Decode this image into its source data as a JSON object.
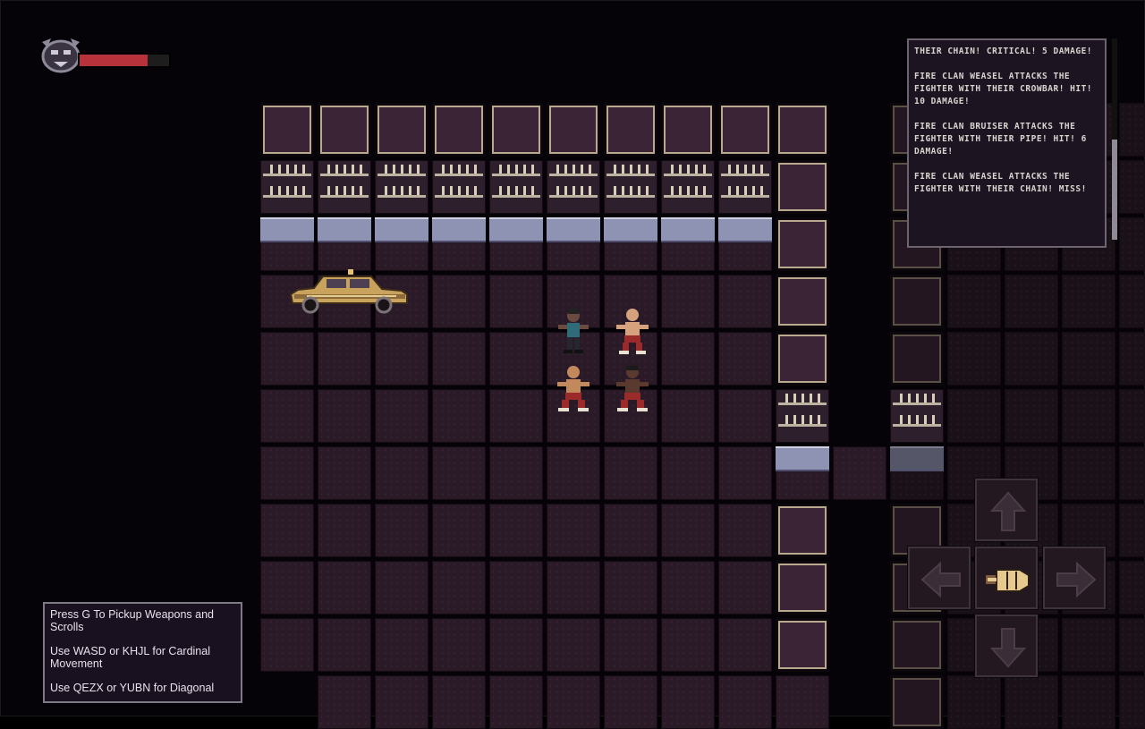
{
  "hud": {
    "health_fraction": 0.76,
    "colors": {
      "health": "#b7323a",
      "health_bg": "#1d1d1d"
    }
  },
  "combat_log": {
    "entries": [
      "Their chain! Critical! 5 damage!",
      "Fire Clan Weasel attacks the Fighter with their crowbar! Hit! 10 damage!",
      "Fire Clan Bruiser attacks the Fighter with their pipe! Hit! 6 damage!",
      "Fire Clan Weasel attacks the Fighter with their chain! Miss!"
    ]
  },
  "help": {
    "lines": [
      "Press G To Pickup Weapons and Scrolls",
      "Use WASD or KHJL for Cardinal Movement",
      "Use QEZX or YUBN for Diagonal"
    ]
  },
  "dpad": {
    "up": "arrow-up-icon",
    "down": "arrow-down-icon",
    "left": "arrow-left-icon",
    "right": "arrow-right-icon",
    "center": "punch-fist-icon"
  }
}
